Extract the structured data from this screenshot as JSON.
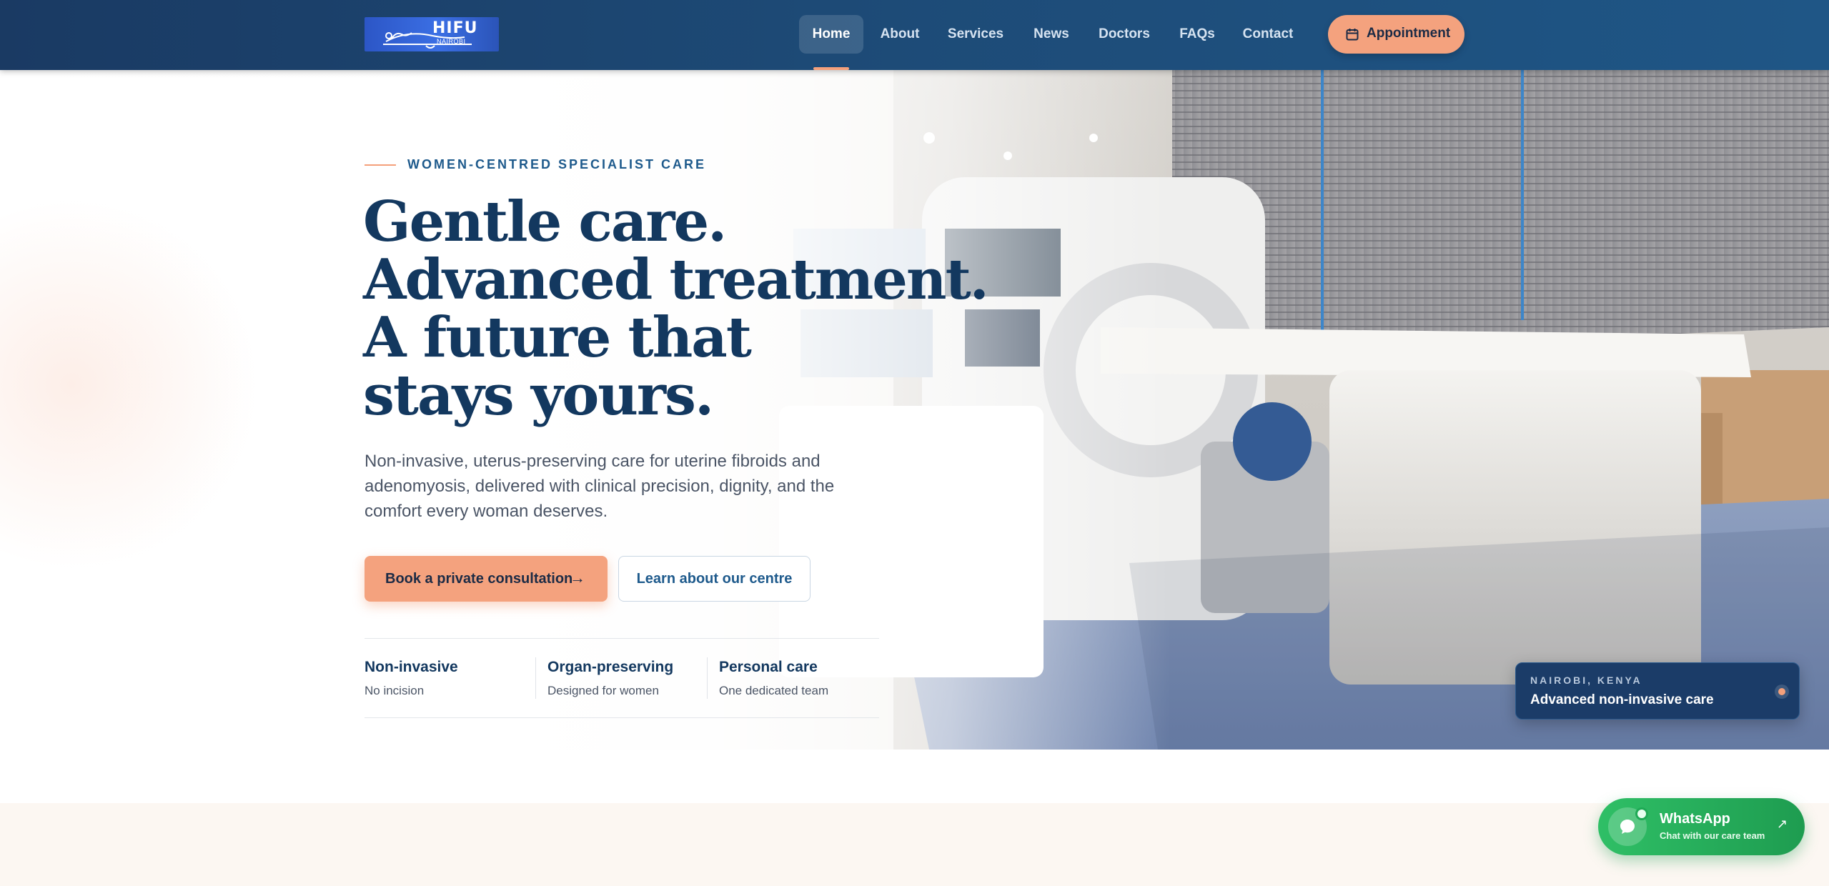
{
  "header": {
    "logo_text": "HIFU",
    "logo_sub": "NAIROBI",
    "nav": [
      {
        "label": "Home",
        "active": true
      },
      {
        "label": "About"
      },
      {
        "label": "Services"
      },
      {
        "label": "News"
      },
      {
        "label": "Doctors"
      },
      {
        "label": "FAQs"
      },
      {
        "label": "Contact"
      }
    ],
    "appointment_label": "Appointment",
    "appointment_icon": "calendar-icon"
  },
  "hero": {
    "eyebrow": "WOMEN-CENTRED SPECIALIST CARE",
    "headline": [
      "Gentle care.",
      "Advanced treatment.",
      "A future that",
      "stays yours."
    ],
    "subtext": "Non-invasive, uterus-preserving care for uterine fibroids and adenomyosis, delivered with clinical precision, dignity, and the comfort every woman deserves.",
    "primary_cta": "Book a private consultation",
    "primary_cta_arrow": "→",
    "secondary_cta": "Learn about our centre",
    "features": [
      {
        "title": "Non-invasive",
        "subtitle": "No incision"
      },
      {
        "title": "Organ-preserving",
        "subtitle": "Designed for women"
      },
      {
        "title": "Personal care",
        "subtitle": "One dedicated team"
      }
    ],
    "location_card": {
      "eyebrow": "NAIROBI, KENYA",
      "title": "Advanced non-invasive care"
    }
  },
  "whatsapp": {
    "title": "WhatsApp",
    "subtitle": "Chat with our care team",
    "icon": "whatsapp-icon",
    "arrow": "↗"
  },
  "colors": {
    "header": "#1d4a76",
    "accent": "#f4a27e",
    "headline": "#13385f",
    "eyebrow": "#1e5a8c",
    "whatsapp": "#25b35f"
  }
}
